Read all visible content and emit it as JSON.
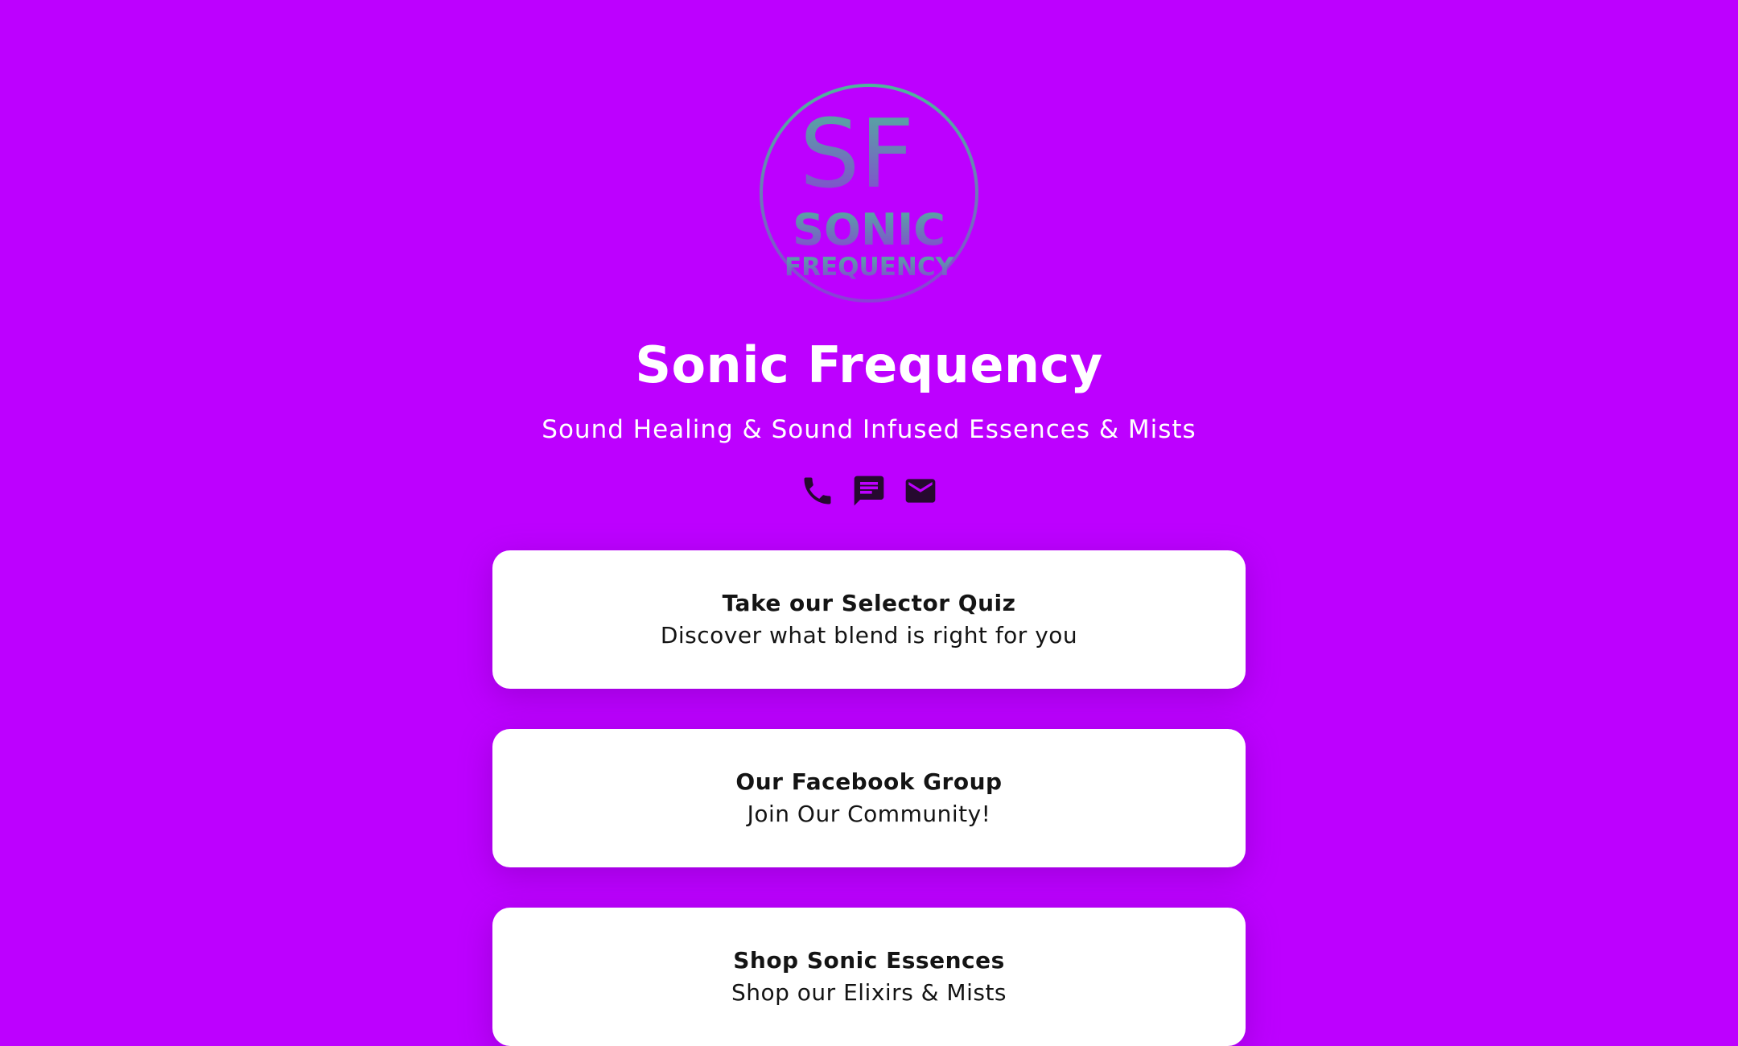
{
  "profile": {
    "name": "Sonic Frequency",
    "tagline": "Sound Healing & Sound Infused Essences & Mists",
    "logo": {
      "monogram": "SF",
      "line1": "SONIC",
      "line2": "FREQUENCY"
    }
  },
  "contacts": [
    {
      "icon": "phone-icon"
    },
    {
      "icon": "message-icon"
    },
    {
      "icon": "email-icon"
    }
  ],
  "links": [
    {
      "title": "Take our Selector Quiz",
      "subtitle": "Discover what blend is right for you"
    },
    {
      "title": "Our Facebook Group",
      "subtitle": "Join Our Community!"
    },
    {
      "title": "Shop Sonic Essences",
      "subtitle": "Shop our Elixirs & Mists"
    }
  ],
  "colors": {
    "background": "#bd00ff",
    "card": "#ffffff",
    "icon": "#26092f",
    "logo_teal": "#4fb59a",
    "logo_purple": "#8a3fd6"
  }
}
